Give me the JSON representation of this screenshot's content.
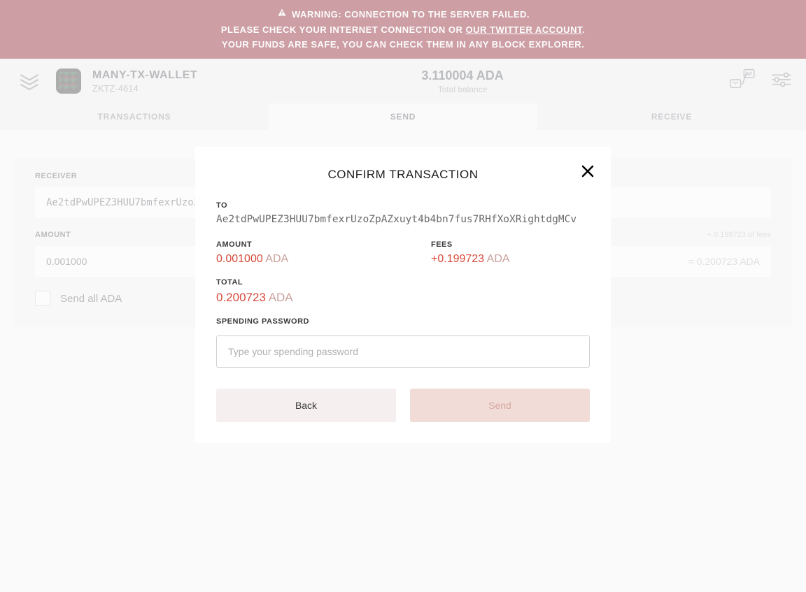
{
  "warning": {
    "line1": "WARNING: CONNECTION TO THE SERVER FAILED.",
    "line2_pre": "PLEASE CHECK YOUR INTERNET CONNECTION OR ",
    "line2_link": "OUR TWITTER ACCOUNT",
    "line2_post": ".",
    "line3": "YOUR FUNDS ARE SAFE, YOU CAN CHECK THEM IN ANY BLOCK EXPLORER."
  },
  "header": {
    "wallet_name": "MANY-TX-WALLET",
    "wallet_code": "ZKTZ-4614",
    "balance": "3.110004 ADA",
    "balance_label": "Total balance"
  },
  "tabs": {
    "transactions": "TRANSACTIONS",
    "send": "SEND",
    "receive": "RECEIVE"
  },
  "form": {
    "receiver_label": "RECEIVER",
    "receiver_value": "Ae2tdPwUPEZ3HUU7bmfexrUzoZ",
    "amount_label": "AMOUNT",
    "amount_value": "0.001000",
    "fees_hint": "+ 0.199723 of fees",
    "amount_suffix": "= 0.200723 ADA",
    "send_all_label": "Send all ADA"
  },
  "modal": {
    "title": "CONFIRM TRANSACTION",
    "to_label": "TO",
    "to_value": "Ae2tdPwUPEZ3HUU7bmfexrUzoZpAZxuyt4b4bn7fus7RHfXoXRightdgMCv",
    "amount_label": "AMOUNT",
    "amount_value": "0.001000",
    "amount_unit": " ADA",
    "fees_label": "FEES",
    "fees_value": "+0.199723",
    "fees_unit": " ADA",
    "total_label": "TOTAL",
    "total_value": "0.200723",
    "total_unit": " ADA",
    "password_label": "SPENDING PASSWORD",
    "password_placeholder": "Type your spending password",
    "back_label": "Back",
    "send_label": "Send"
  }
}
